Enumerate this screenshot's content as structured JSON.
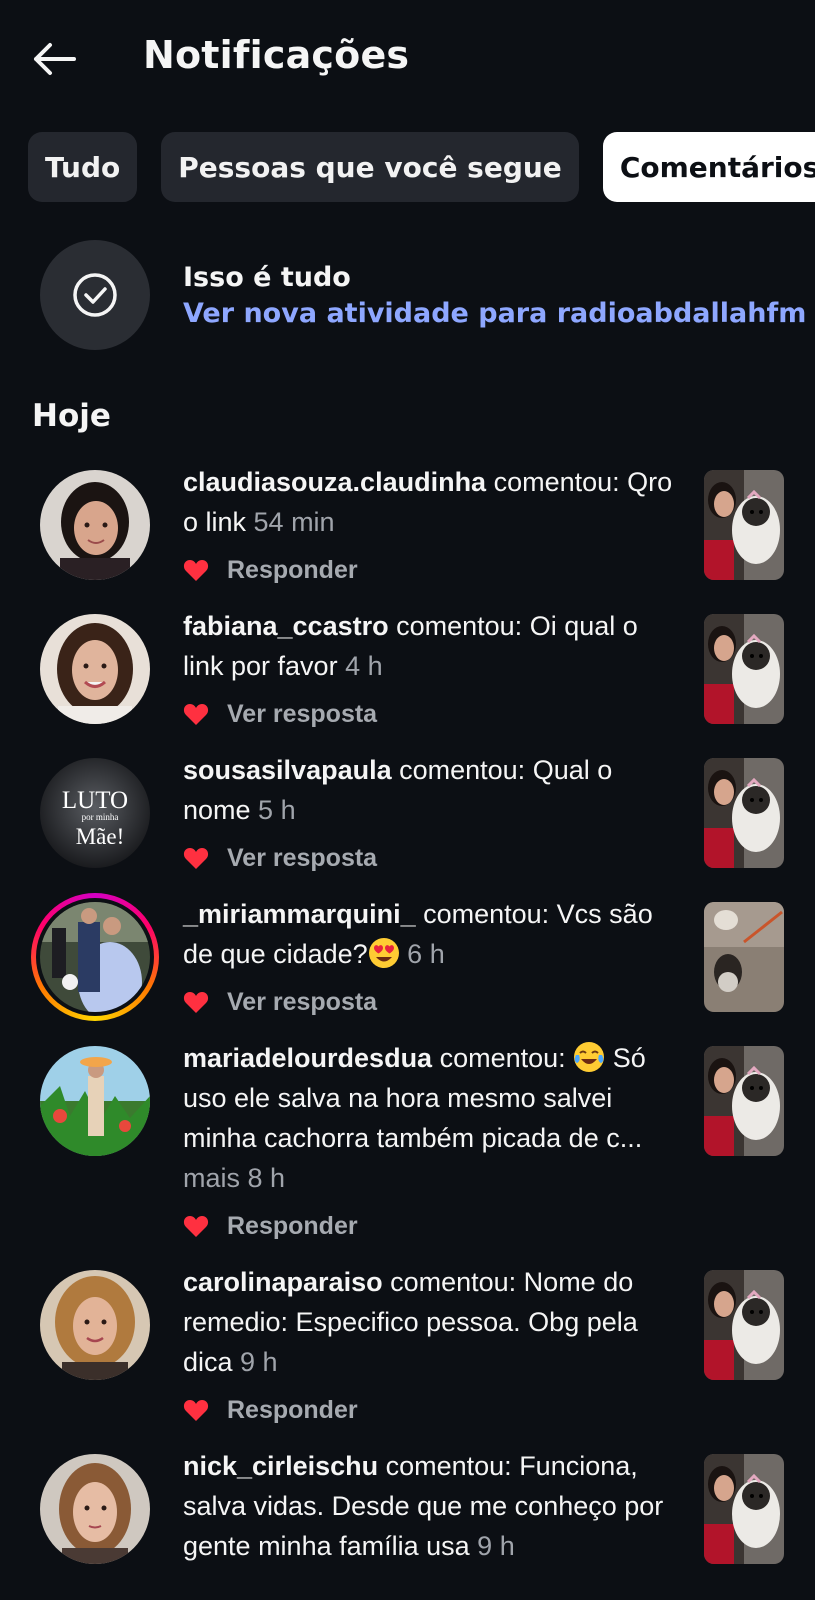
{
  "header": {
    "title": "Notificações"
  },
  "tabs": [
    {
      "label": "Tudo",
      "active": false
    },
    {
      "label": "Pessoas que você segue",
      "active": false
    },
    {
      "label": "Comentários",
      "active": true
    }
  ],
  "caught_up": {
    "title": "Isso é tudo",
    "link": "Ver nova atividade para radioabdallahfm"
  },
  "section": {
    "title": "Hoje"
  },
  "notifications": [
    {
      "user": "claudiasouza.claudinha",
      "verb": " comentou:",
      "comment": " Qro o link",
      "time": " 54 min",
      "action": "Responder"
    },
    {
      "user": "fabiana_ccastro",
      "verb": " comentou:",
      "comment": " Oi qual o link por favor",
      "time": " 4 h",
      "action": "Ver resposta"
    },
    {
      "user": "sousasilvapaula",
      "verb": " comentou:",
      "comment": " Qual o nome",
      "time": " 5 h",
      "action": "Ver resposta",
      "avatar_text": [
        "LUTO",
        "por minha",
        "Mãe!"
      ]
    },
    {
      "user": "_miriammarquini_",
      "verb": " comentou:",
      "comment": " Vcs são de que cidade?",
      "emoji": "heart-eyes",
      "time": " 6 h",
      "action": "Ver resposta"
    },
    {
      "user": "mariadelourdesdua",
      "verb": " comentou:",
      "emoji": "tears-of-joy",
      "comment": "Só uso ele salva na hora mesmo salvei minha cachorra também picada de c...",
      "more": " mais",
      "time": " 8 h",
      "action": "Responder"
    },
    {
      "user": "carolinaparaiso",
      "verb": " comentou:",
      "comment": " Nome do remedio: Especifico pessoa. Obg pela dica",
      "time": " 9 h",
      "action": "Responder"
    },
    {
      "user": "nick_cirleischu",
      "verb": " comentou:",
      "comment": " Funciona, salva vidas. Desde que me conheço por gente minha família usa",
      "time": " 9 h"
    }
  ],
  "colors": {
    "background": "#0c0f14",
    "link": "#8ea7ff",
    "heart": "#ff3040",
    "tab_bg": "#24272e"
  }
}
